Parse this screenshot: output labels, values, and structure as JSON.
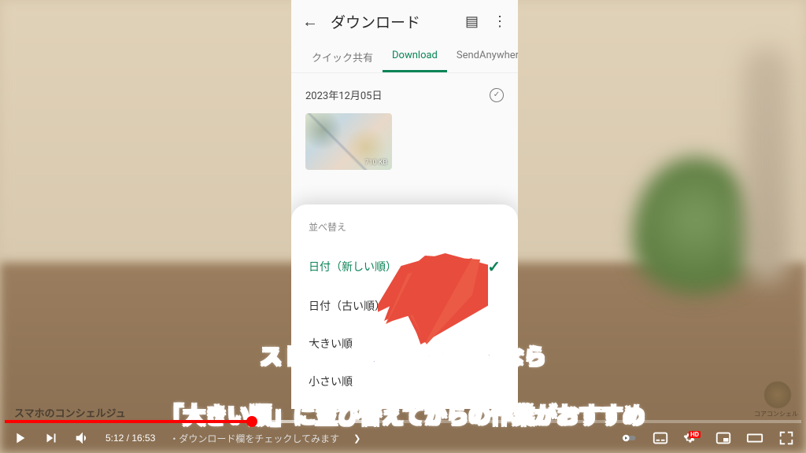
{
  "phone": {
    "title": "ダウンロード",
    "tabs": [
      "クイック共有",
      "Download",
      "SendAnywhere"
    ],
    "active_tab_index": 1,
    "date_group": "2023年12月05日",
    "thumbnail_size": "710 KB"
  },
  "sort_sheet": {
    "title": "並べ替え",
    "options": [
      "日付（新しい順）",
      "日付（古い順）",
      "大きい順",
      "小さい順"
    ],
    "selected_index": 0
  },
  "caption": {
    "line1": "ストレージに空きを作るなら",
    "highlight": "「大きい順」",
    "line2_rest": "に並び替えてからの作業がおすすめ"
  },
  "player": {
    "current_time": "5:12",
    "total_time": "16:53",
    "chapter": "・ダウンロード欄をチェックしてみます"
  },
  "watermark": {
    "channel": "スマホのコンシェルジュ",
    "corner": "コアコンシェル"
  },
  "colors": {
    "accent_green": "#0b8457",
    "caption_blue": "#2a5a9a",
    "caption_red": "#c03030",
    "yt_red": "#ff0000"
  }
}
